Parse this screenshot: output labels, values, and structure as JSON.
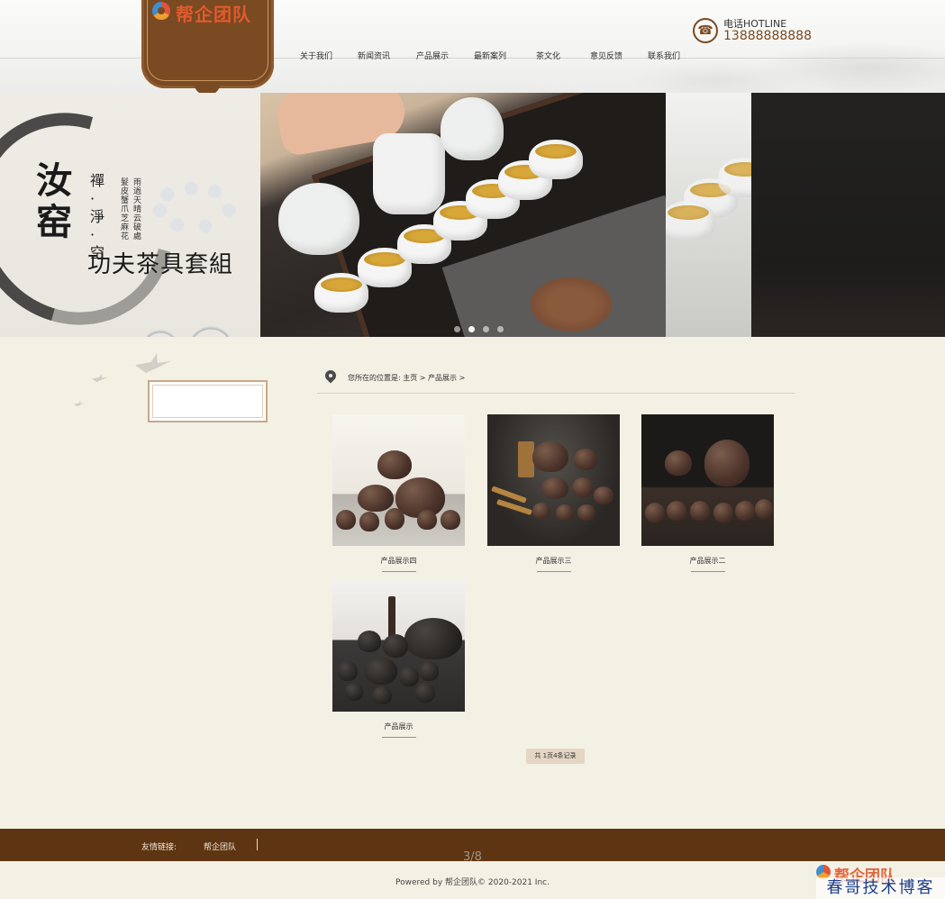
{
  "header": {
    "logo_text": "帮企团队",
    "nav": [
      {
        "label": "关于我们"
      },
      {
        "label": "新闻资讯"
      },
      {
        "label": "产品展示"
      },
      {
        "label": "最新案列"
      },
      {
        "label": "茶文化"
      },
      {
        "label": "意见反馈"
      },
      {
        "label": "联系我们"
      }
    ],
    "hotline_label": "电话HOTLINE",
    "hotline_number": "13888888888"
  },
  "banner": {
    "title_big": [
      "汝",
      "窑"
    ],
    "subtitle": [
      "禪",
      "·",
      "淨",
      "·",
      "空"
    ],
    "verse_1": [
      "雨",
      "過",
      "天",
      "晴",
      "云",
      "破",
      "處"
    ],
    "verse_2": [
      "髮",
      "皮",
      "蟹",
      "爪",
      "芝",
      "麻",
      "花"
    ],
    "main_title": "功夫茶具套組",
    "active_slide": 2,
    "slide_count": 4
  },
  "breadcrumb": {
    "prefix": "您所在的位置是:",
    "home": "主页",
    "separator": ">",
    "current": "产品展示",
    "trailing": ">"
  },
  "products": [
    {
      "name": "产品展示四"
    },
    {
      "name": "产品展示三"
    },
    {
      "name": "产品展示二"
    },
    {
      "name": "产品展示"
    }
  ],
  "pagination": {
    "text": "共 1页4条记录"
  },
  "footer": {
    "friend_label": "友情链接:",
    "friend_link": "帮企团队",
    "page_counter": "3/8",
    "copyright": "Powered by 帮企团队© 2020-2021 Inc."
  },
  "watermark": {
    "logo": "帮企团队",
    "text": "春哥技术博客"
  },
  "colors": {
    "brand_brown": "#7a4a22",
    "footer_brown": "#5e3512",
    "page_background": "#f3f0e4",
    "logo_orange": "#e25a2c",
    "pagination_bg": "#e4d6c3"
  }
}
